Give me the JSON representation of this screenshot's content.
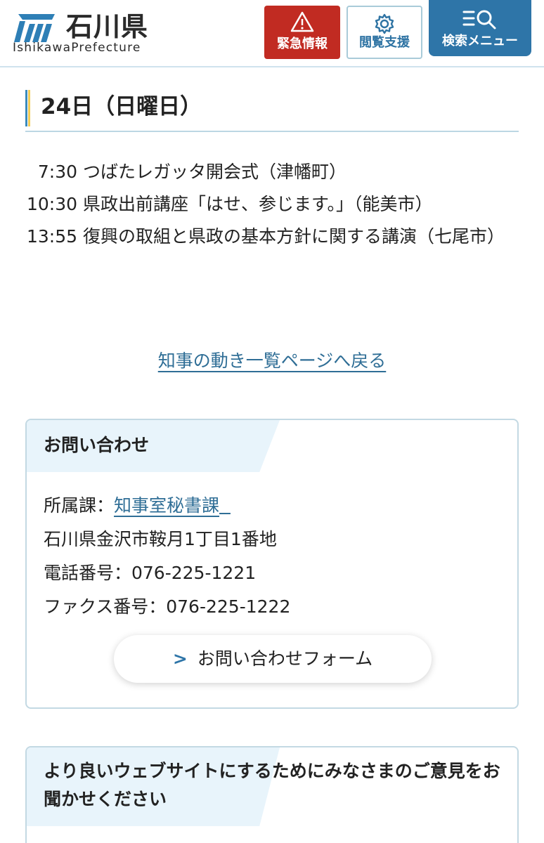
{
  "header": {
    "logo_name": "石川県",
    "logo_en": "IshikawaPrefecture",
    "emergency_label": "緊急情報",
    "accessibility_label": "閲覧支援",
    "search_menu_label": "検索メニュー",
    "colors": {
      "emergency": "#c12b22",
      "search": "#2e75a8",
      "accent": "#2e73a3"
    }
  },
  "date_heading": "24日（日曜日）",
  "schedule": [
    "  7:30 つばたレガッタ開会式（津幡町）",
    "10:30 県政出前講座「はせ、参じます。」（能美市）",
    "13:55 復興の取組と県政の基本方針に関する講演（七尾市）"
  ],
  "back_link": "知事の動き一覧ページへ戻る",
  "contact": {
    "title": "お問い合わせ",
    "department_label": "所属課：",
    "department_link": "知事室秘書課",
    "address": "石川県金沢市鞍月1丁目1番地",
    "phone": "電話番号：076-225-1221",
    "fax": "ファクス番号：076-225-1222",
    "form_button": "お問い合わせフォーム"
  },
  "feedback": {
    "title": "より良いウェブサイトにするためにみなさまのご意見をお聞かせください"
  }
}
